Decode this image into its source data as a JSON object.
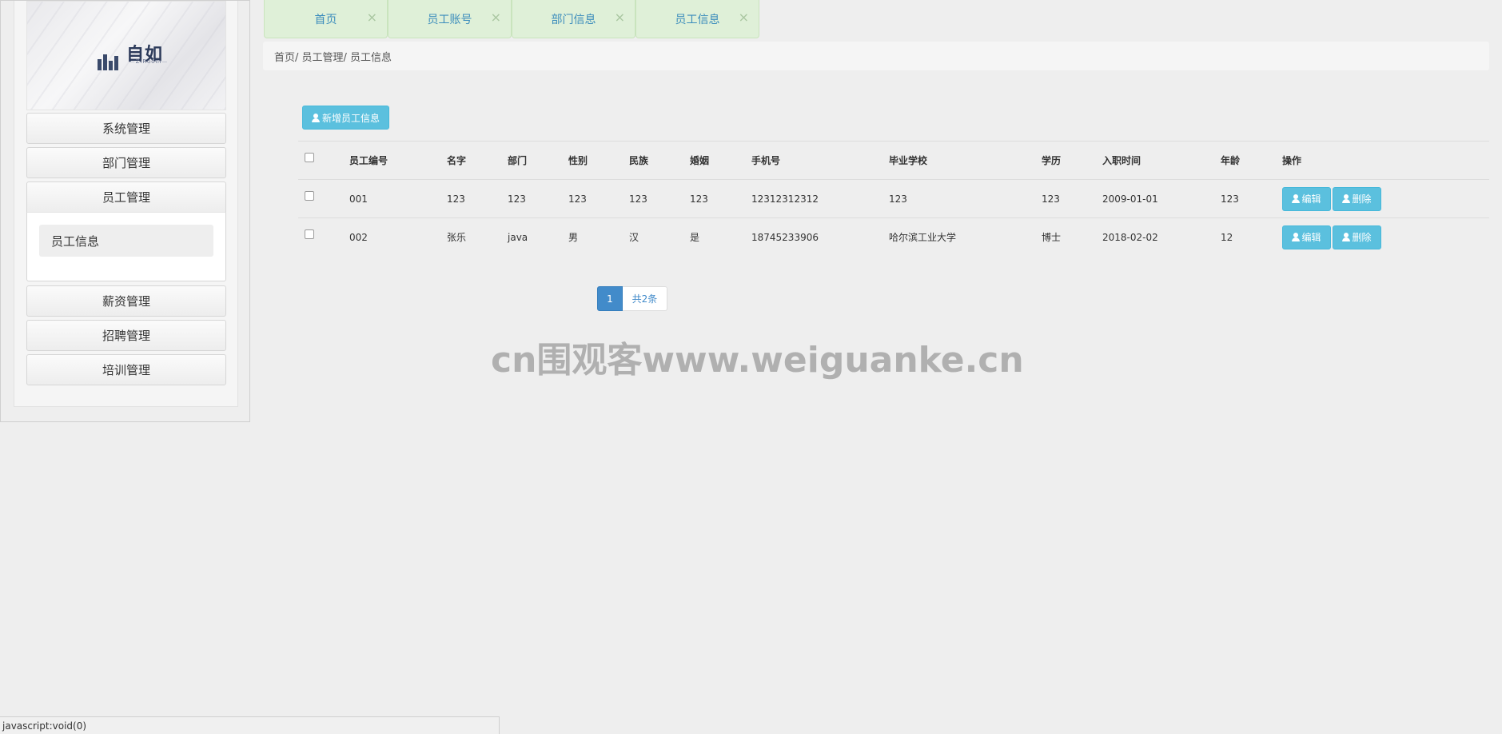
{
  "logo": {
    "text": "自如",
    "sub": "ZiRoom"
  },
  "sidebar": {
    "items": [
      {
        "label": "系统管理"
      },
      {
        "label": "部门管理"
      },
      {
        "label": "员工管理"
      },
      {
        "label": "薪资管理"
      },
      {
        "label": "招聘管理"
      },
      {
        "label": "培训管理"
      }
    ],
    "submenu": {
      "label": "员工信息"
    }
  },
  "tabs": [
    {
      "label": "首页"
    },
    {
      "label": "员工账号"
    },
    {
      "label": "部门信息"
    },
    {
      "label": "员工信息"
    }
  ],
  "tab_close": "×",
  "breadcrumb": "首页/ 员工管理/ 员工信息",
  "toolbar": {
    "add_label": "新增员工信息"
  },
  "table": {
    "headers": [
      "员工编号",
      "名字",
      "部门",
      "性别",
      "民族",
      "婚姻",
      "手机号",
      "毕业学校",
      "学历",
      "入职时间",
      "年龄",
      "操作"
    ],
    "rows": [
      {
        "id": "001",
        "name": "123",
        "dept": "123",
        "gender": "123",
        "ethnic": "123",
        "marriage": "123",
        "phone": "12312312312",
        "school": "123",
        "edu": "123",
        "hire": "2009-01-01",
        "age": "123"
      },
      {
        "id": "002",
        "name": "张乐",
        "dept": "java",
        "gender": "男",
        "ethnic": "汉",
        "marriage": "是",
        "phone": "18745233906",
        "school": "哈尔滨工业大学",
        "edu": "博士",
        "hire": "2018-02-02",
        "age": "12"
      }
    ],
    "edit_label": "编辑",
    "delete_label": "删除"
  },
  "pagination": {
    "current": "1",
    "total_label": "共2条"
  },
  "watermark": "cn围观客www.weiguanke.cn",
  "status_bar": "javascript:void(0)",
  "colors": {
    "info": "#5bc0de",
    "primary": "#428bca",
    "tab_bg": "#dff0d8",
    "tab_text": "#3c8dbc"
  }
}
